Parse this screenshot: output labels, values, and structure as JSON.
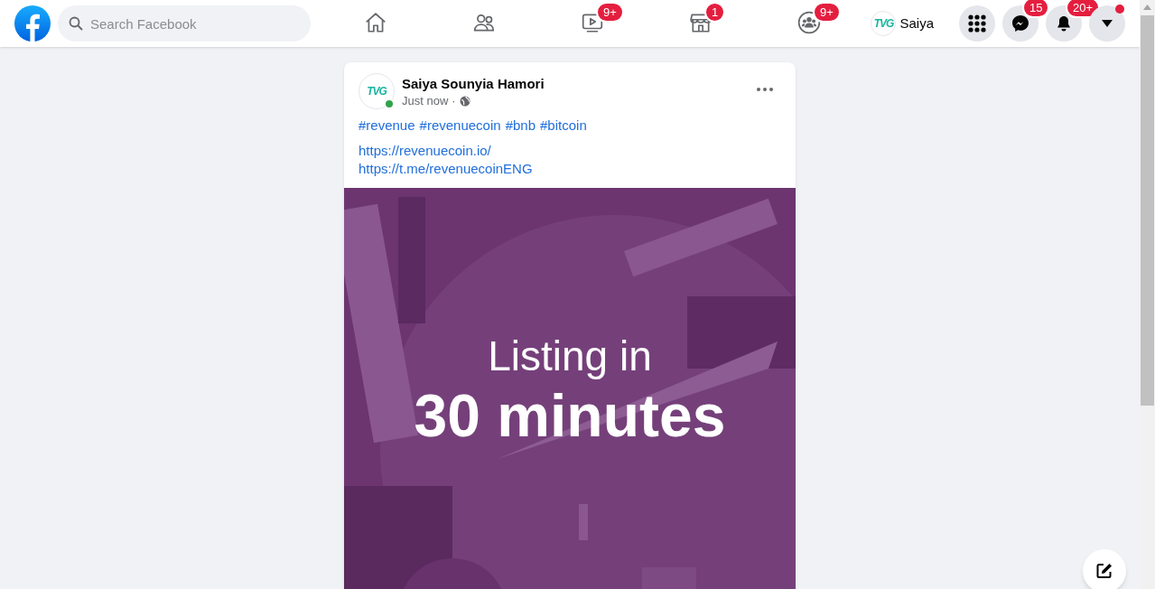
{
  "header": {
    "search": {
      "placeholder": "Search Facebook"
    },
    "nav": [
      {
        "kind": "home",
        "selected": false
      },
      {
        "kind": "friends",
        "selected": false
      },
      {
        "kind": "watch",
        "selected": false,
        "badge": "9+"
      },
      {
        "kind": "marketplace",
        "selected": false,
        "badge": "1"
      },
      {
        "kind": "groups",
        "selected": false,
        "badge": "9+"
      }
    ],
    "profile": {
      "logo": "TVG",
      "name": "Saiya"
    },
    "actions": [
      {
        "kind": "menu"
      },
      {
        "kind": "messenger",
        "badge": "15"
      },
      {
        "kind": "notifications",
        "badge": "20+"
      },
      {
        "kind": "account",
        "dot": true
      }
    ]
  },
  "post": {
    "author": "Saiya Sounyia Hamori",
    "logo": "TVG",
    "online": true,
    "time": "Just now",
    "separator": "·",
    "hashtags": [
      "#revenue",
      "#revenuecoin",
      "#bnb",
      "#bitcoin"
    ],
    "links": [
      "https://revenuecoin.io/",
      "https://t.me/revenuecoinENG"
    ],
    "image": {
      "kind": "picture",
      "lines": [
        "Listing in",
        "30 minutes"
      ]
    }
  }
}
